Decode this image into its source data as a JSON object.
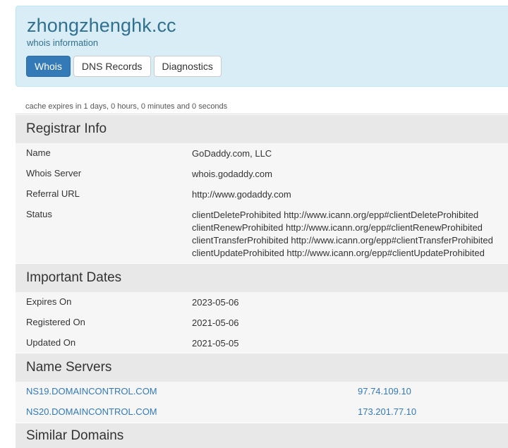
{
  "header": {
    "domain": "zhongzhenghk.cc",
    "subtitle": "whois information",
    "tabs": [
      {
        "label": "Whois",
        "active": true
      },
      {
        "label": "DNS Records",
        "active": false
      },
      {
        "label": "Diagnostics",
        "active": false
      }
    ]
  },
  "cache_note": "cache expires in 1 days, 0 hours, 0 minutes and 0 seconds",
  "registrar_info": {
    "title": "Registrar Info",
    "rows": [
      {
        "label": "Name",
        "value": "GoDaddy.com, LLC"
      },
      {
        "label": "Whois Server",
        "value": "whois.godaddy.com"
      },
      {
        "label": "Referral URL",
        "value": "http://www.godaddy.com"
      }
    ],
    "status_label": "Status",
    "status_values": [
      "clientDeleteProhibited http://www.icann.org/epp#clientDeleteProhibited",
      "clientRenewProhibited http://www.icann.org/epp#clientRenewProhibited",
      "clientTransferProhibited http://www.icann.org/epp#clientTransferProhibited",
      "clientUpdateProhibited http://www.icann.org/epp#clientUpdateProhibited"
    ]
  },
  "important_dates": {
    "title": "Important Dates",
    "rows": [
      {
        "label": "Expires On",
        "value": "2023-05-06"
      },
      {
        "label": "Registered On",
        "value": "2021-05-06"
      },
      {
        "label": "Updated On",
        "value": "2021-05-05"
      }
    ]
  },
  "name_servers": {
    "title": "Name Servers",
    "rows": [
      {
        "host": "NS19.DOMAINCONTROL.COM",
        "ip": "97.74.109.10"
      },
      {
        "host": "NS20.DOMAINCONTROL.COM",
        "ip": "173.201.77.10"
      }
    ]
  },
  "similar_domains": {
    "title": "Similar Domains"
  },
  "colors": {
    "header_bg": "#d9edf7",
    "header_text": "#31708f",
    "active_tab": "#337ab7",
    "link": "#337ab7",
    "section_head_bg": "#e8e8e8",
    "section_body_bg": "#f6f6f6"
  }
}
